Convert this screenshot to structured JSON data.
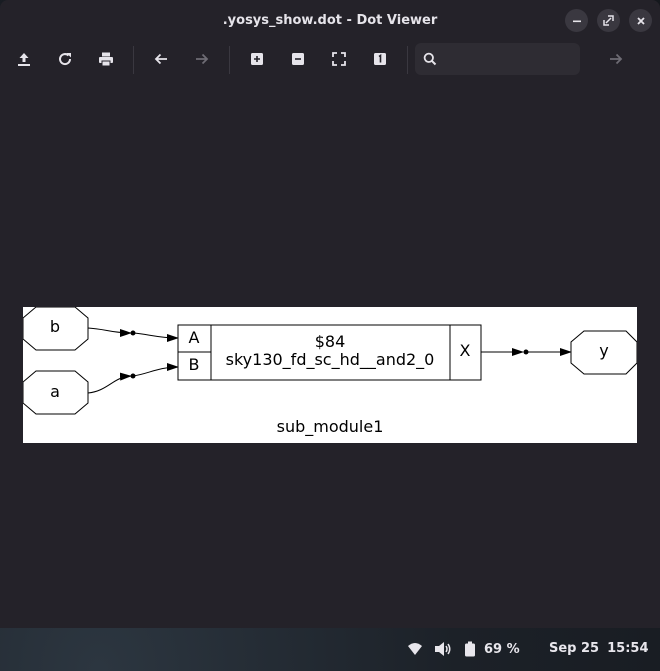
{
  "window": {
    "title": ".yosys_show.dot - Dot Viewer"
  },
  "toolbar": {
    "search_placeholder": "",
    "buttons": [
      "open-icon",
      "reload-icon",
      "print-icon",
      "back-icon",
      "forward-icon",
      "zoom-in-icon",
      "zoom-out-icon",
      "zoom-fit-icon",
      "zoom-100-icon",
      "find-next-icon"
    ]
  },
  "graph": {
    "module_label": "sub_module1",
    "cell_id": "$84",
    "cell_type": "sky130_fd_sc_hd__and2_0",
    "cell_ports_in": [
      "A",
      "B"
    ],
    "cell_port_out": "X",
    "inputs": [
      "b",
      "a"
    ],
    "output": "y"
  },
  "taskbar": {
    "battery": "69 %",
    "date": "Sep 25",
    "time": "15:54"
  },
  "colors": {
    "window_bg": "#242229",
    "graph_bg": "#ffffff",
    "text": "#e6e4ea"
  }
}
